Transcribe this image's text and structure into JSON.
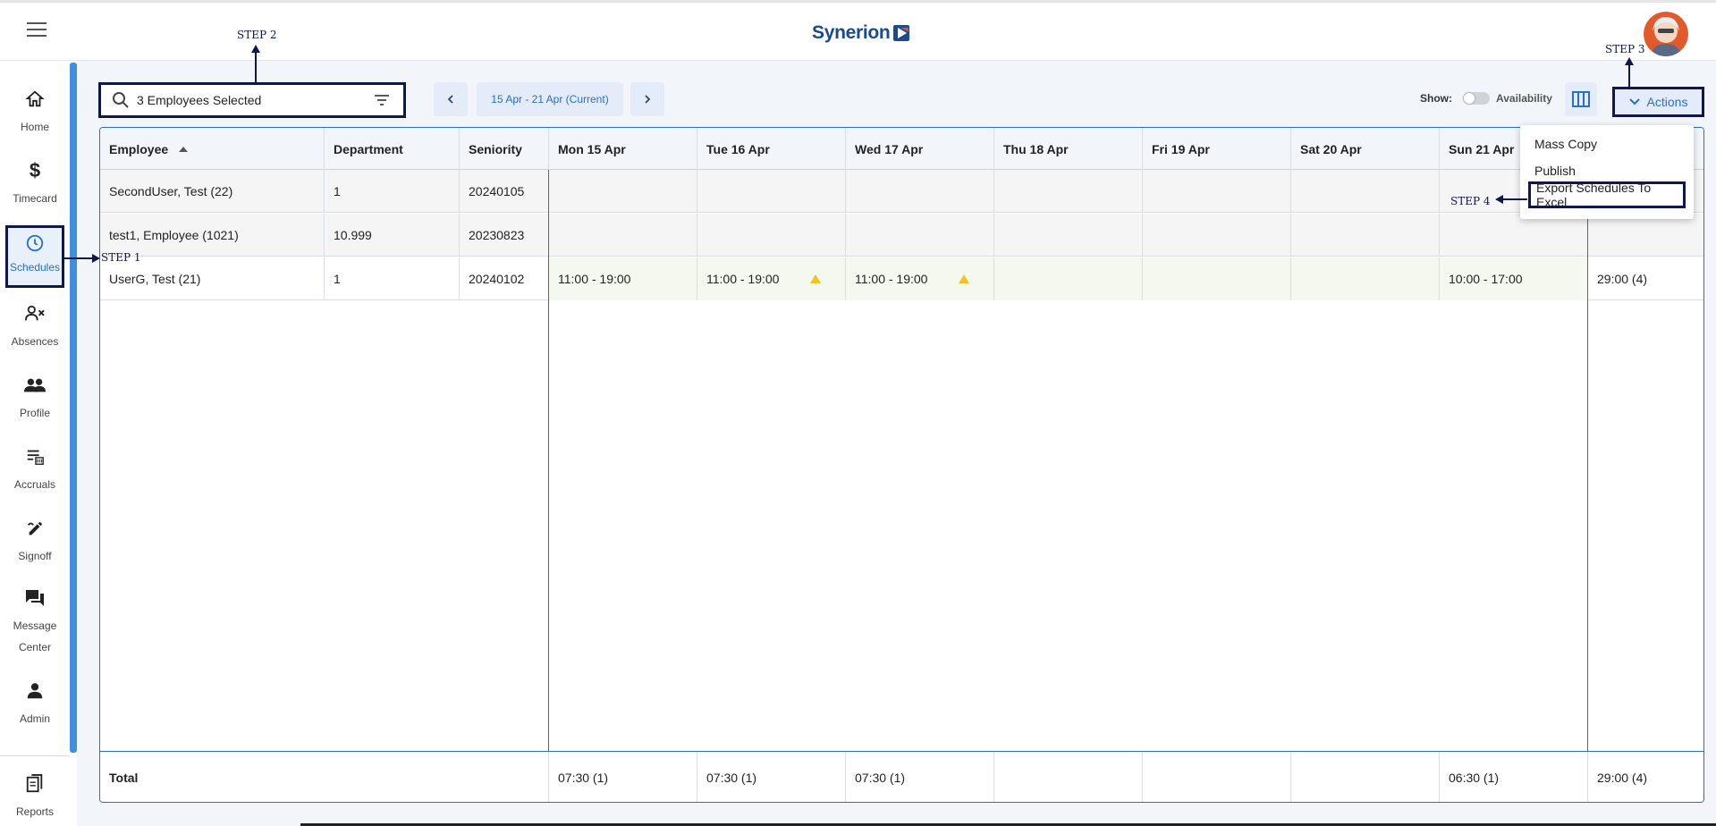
{
  "header": {
    "brand": "Synerion"
  },
  "sidebar": {
    "items": [
      {
        "label": "Home",
        "icon": "home-icon"
      },
      {
        "label": "Timecard",
        "icon": "dollar-icon"
      },
      {
        "label": "Schedules",
        "icon": "clock-icon",
        "active": true
      },
      {
        "label": "Absences",
        "icon": "person-x-icon"
      },
      {
        "label": "Profile",
        "icon": "people-icon"
      },
      {
        "label": "Accruals",
        "icon": "accruals-icon"
      },
      {
        "label": "Signoff",
        "icon": "signoff-icon"
      },
      {
        "label": "Message",
        "label2": "Center",
        "icon": "chat-icon"
      },
      {
        "label": "Admin",
        "icon": "person-icon"
      },
      {
        "label": "Reports",
        "icon": "reports-icon"
      }
    ]
  },
  "toolbar": {
    "search_value": "3 Employees Selected",
    "date_range": "15 Apr - 21 Apr (Current)",
    "show_label": "Show:",
    "availability_label": "Availability",
    "actions_label": "Actions"
  },
  "actions_menu": {
    "items": [
      "Mass Copy",
      "Publish",
      "Export Schedules To Excel"
    ]
  },
  "table": {
    "columns": [
      "Employee",
      "Department",
      "Seniority",
      "Mon 15 Apr",
      "Tue 16 Apr",
      "Wed 17 Apr",
      "Thu 18 Apr",
      "Fri 19 Apr",
      "Sat 20 Apr",
      "Sun 21 Apr"
    ],
    "rows": [
      {
        "employee": "SecondUser, Test (22)",
        "department": "1",
        "seniority": "20240105",
        "days": [
          "",
          "",
          "",
          "",
          "",
          "",
          ""
        ],
        "total": ""
      },
      {
        "employee": "test1, Employee (1021)",
        "department": "10.999",
        "seniority": "20230823",
        "days": [
          "",
          "",
          "",
          "",
          "",
          "",
          ""
        ],
        "total": ""
      },
      {
        "employee": "UserG, Test (21)",
        "department": "1",
        "seniority": "20240102",
        "days": [
          "11:00 - 19:00",
          "11:00 - 19:00",
          "11:00 - 19:00",
          "",
          "",
          "",
          "10:00 - 17:00"
        ],
        "total": "29:00 (4)"
      }
    ],
    "footer": {
      "label": "Total",
      "days": [
        "07:30 (1)",
        "07:30 (1)",
        "07:30 (1)",
        "",
        "",
        "",
        "06:30 (1)"
      ],
      "total": "29:00 (4)"
    }
  },
  "annotations": {
    "step1": "STEP 1",
    "step2": "STEP 2",
    "step3": "STEP 3",
    "step4": "STEP 4"
  },
  "colors": {
    "accent": "#2a6fc7",
    "annotation": "#10174a",
    "warning": "#f2c41e"
  }
}
